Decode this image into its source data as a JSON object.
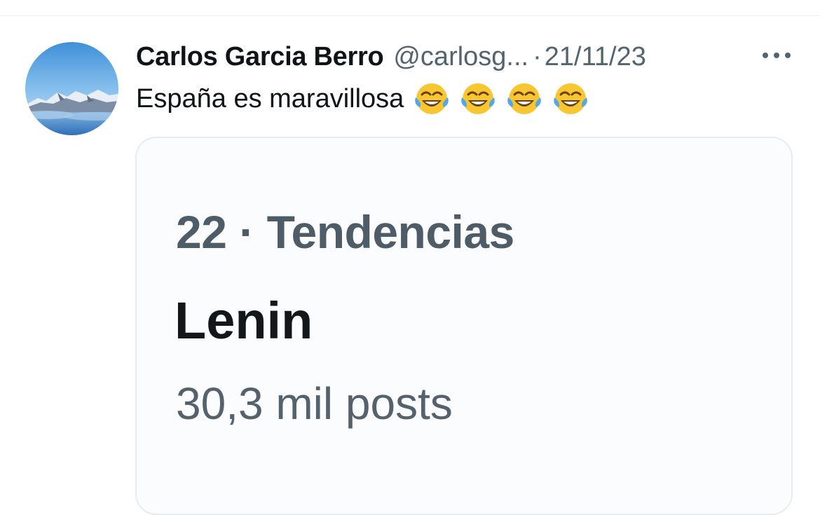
{
  "tweet": {
    "author_name": "Carlos Garcia Berro",
    "author_handle": "@carlosg...",
    "separator": "·",
    "date": "21/11/23",
    "more_icon": "more-horizontal-icon",
    "text": "España es maravillosa",
    "emojis": [
      "😂",
      "😂",
      "😂",
      "😂"
    ],
    "avatar_icon": "mountain-landscape-avatar"
  },
  "card": {
    "trend_meta": "22 · Tendencias",
    "trend_title": "Lenin",
    "trend_count": "30,3 mil posts"
  },
  "colors": {
    "secondary_text": "#536471",
    "primary_text": "#0f1419",
    "border": "#e6ecf0"
  }
}
